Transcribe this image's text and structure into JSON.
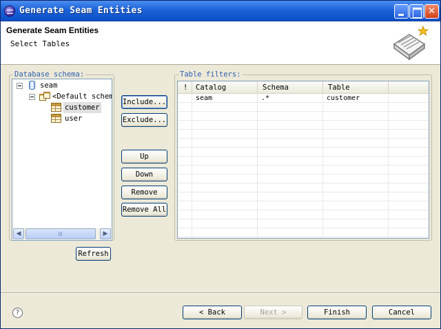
{
  "window": {
    "title": "Generate Seam Entities"
  },
  "banner": {
    "title": "Generate Seam Entities",
    "subtitle": "Select Tables"
  },
  "schema_panel": {
    "legend": "Database schema:",
    "tree": [
      {
        "label": "seam",
        "icon": "database-icon",
        "expanded": true
      },
      {
        "label": "<Default schema",
        "icon": "schema-icon",
        "expanded": true
      },
      {
        "label": "customer",
        "icon": "table-icon",
        "selected": true
      },
      {
        "label": "user",
        "icon": "table-icon"
      }
    ],
    "refresh_label": "Refresh"
  },
  "actions": {
    "include": "Include...",
    "exclude": "Exclude...",
    "up": "Up",
    "down": "Down",
    "remove": "Remove",
    "remove_all": "Remove All"
  },
  "filters_panel": {
    "legend": "Table filters:",
    "columns": [
      "!",
      "Catalog",
      "Schema",
      "Table"
    ],
    "rows": [
      {
        "flag": "",
        "catalog": "seam",
        "schema": ".*",
        "table": "customer"
      }
    ]
  },
  "footer": {
    "help": "?",
    "back": "< Back",
    "next": "Next >",
    "finish": "Finish",
    "cancel": "Cancel"
  }
}
